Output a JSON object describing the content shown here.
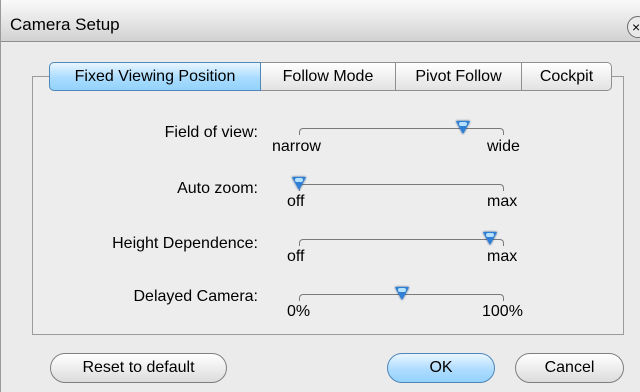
{
  "window": {
    "title": "Camera Setup",
    "close_symbol": "×"
  },
  "tabs": [
    {
      "label": "Fixed Viewing Position",
      "active": true
    },
    {
      "label": "Follow Mode",
      "active": false
    },
    {
      "label": "Pivot Follow",
      "active": false
    },
    {
      "label": "Cockpit",
      "active": false
    }
  ],
  "settings": {
    "field_of_view": {
      "label": "Field of view:",
      "min_label": "narrow",
      "max_label": "wide",
      "value_fraction": 0.8
    },
    "auto_zoom": {
      "label": "Auto zoom:",
      "min_label": "off",
      "max_label": "max",
      "value_fraction": 0.0
    },
    "height_dependence": {
      "label": "Height Dependence:",
      "min_label": "off",
      "max_label": "max",
      "value_fraction": 0.93
    },
    "delayed_camera": {
      "label": "Delayed Camera:",
      "min_label": "0%",
      "max_label": "100%",
      "value_fraction": 0.5
    }
  },
  "buttons": {
    "reset": "Reset to default",
    "ok": "OK",
    "cancel": "Cancel"
  },
  "colors": {
    "accent": "#2f7fd6",
    "active_tab": "#a9dcff"
  }
}
